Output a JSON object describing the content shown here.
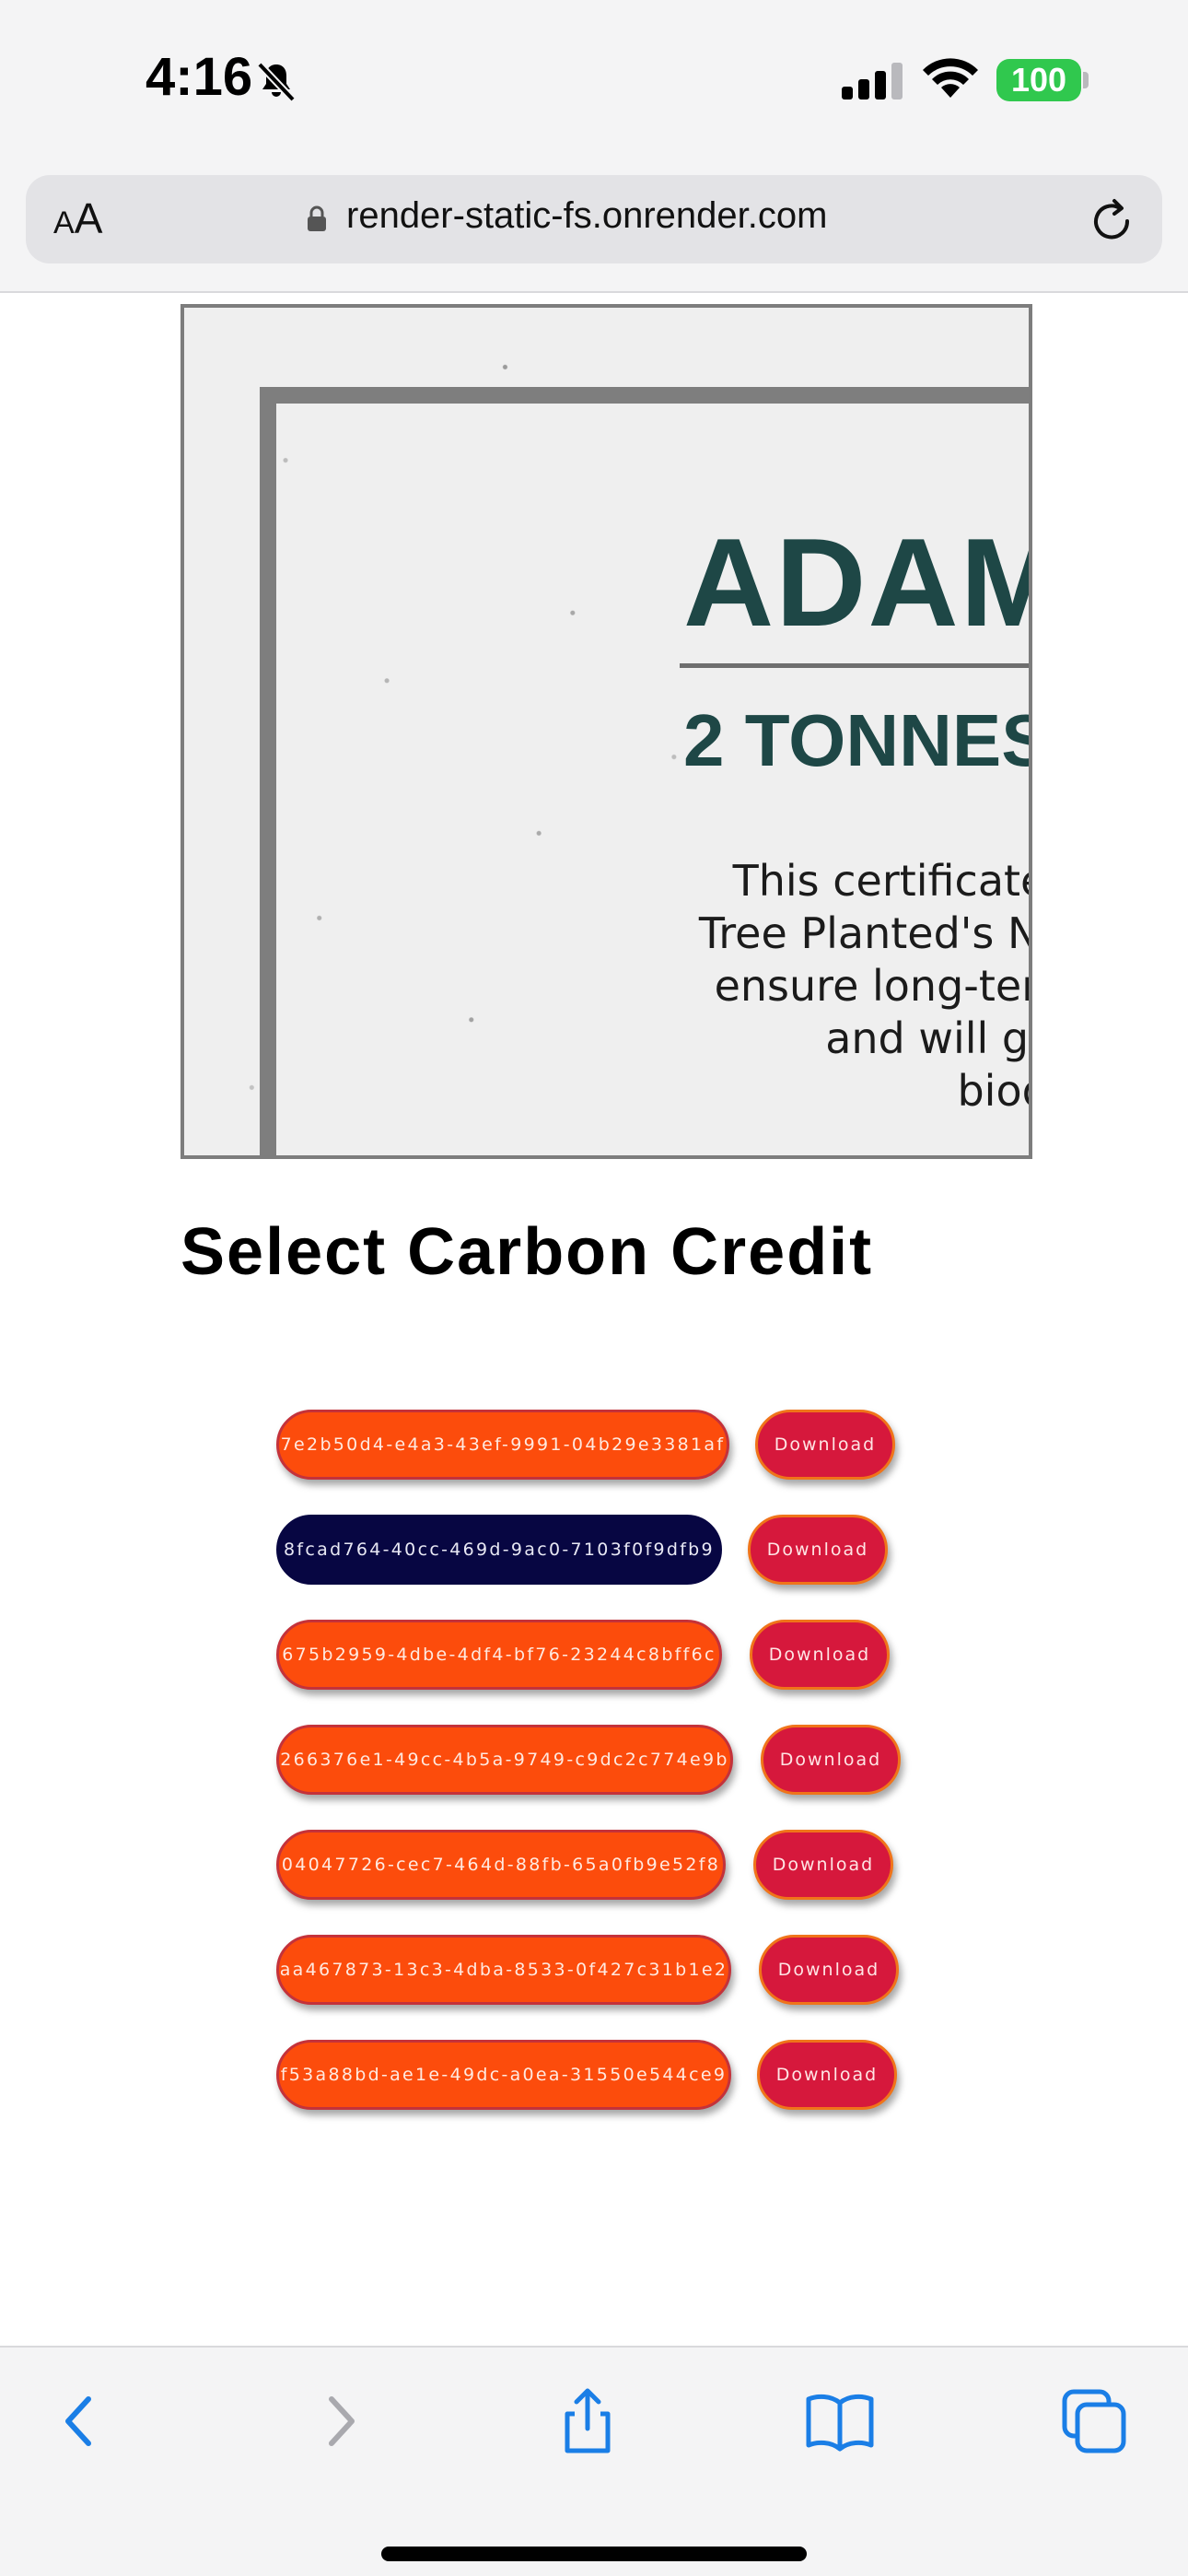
{
  "status_bar": {
    "time": "4:16",
    "battery": "100",
    "icons": [
      "bell-slash-icon",
      "cellular-signal-icon",
      "wifi-icon",
      "battery-icon"
    ]
  },
  "browser": {
    "text_size_button": {
      "small": "A",
      "large": "A"
    },
    "url": "render-static-fs.onrender.com",
    "icons": [
      "lock-icon",
      "reload-icon"
    ]
  },
  "certificate": {
    "name": "ADAM",
    "tonnes": "2 TONNES",
    "body_lines": [
      "This certificate ackr",
      "Tree Planted's Nature",
      "ensure long-term for",
      "and will genera",
      "biodivers"
    ]
  },
  "section_title": "Select Carbon Credit",
  "credits": [
    {
      "id": "7e2b50d4-e4a3-43ef-9991-04b29e3381af",
      "download_label": "Download",
      "selected": false
    },
    {
      "id": "8fcad764-40cc-469d-9ac0-7103f0f9dfb9",
      "download_label": "Download",
      "selected": true
    },
    {
      "id": "675b2959-4dbe-4df4-bf76-23244c8bff6c",
      "download_label": "Download",
      "selected": false
    },
    {
      "id": "266376e1-49cc-4b5a-9749-c9dc2c774e9b",
      "download_label": "Download",
      "selected": false
    },
    {
      "id": "04047726-cec7-464d-88fb-65a0fb9e52f8",
      "download_label": "Download",
      "selected": false
    },
    {
      "id": "aa467873-13c3-4dba-8533-0f427c31b1e2",
      "download_label": "Download",
      "selected": false
    },
    {
      "id": "f53a88bd-ae1e-49dc-a0ea-31550e544ce9",
      "download_label": "Download",
      "selected": false
    }
  ],
  "colors": {
    "credit_button": "#fc4c0c",
    "credit_selected": "#070642",
    "download_button": "#d6183c",
    "certificate_text": "#1e4746",
    "battery": "#30c84e",
    "toolbar_accent": "#1a7ee6"
  },
  "toolbar": {
    "icons": [
      "back-icon",
      "forward-icon",
      "share-icon",
      "bookmarks-icon",
      "tabs-icon"
    ]
  }
}
